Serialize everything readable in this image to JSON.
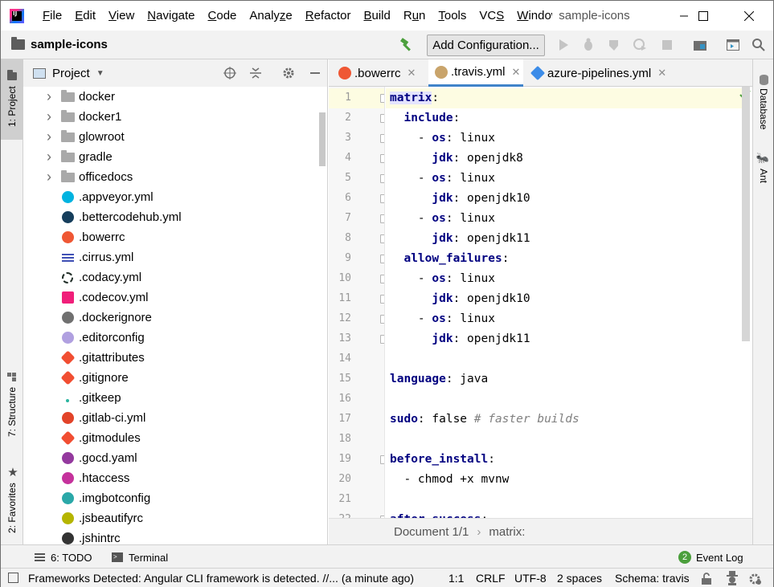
{
  "window": {
    "title": "sample-icons",
    "menu": [
      "File",
      "Edit",
      "View",
      "Navigate",
      "Code",
      "Analyze",
      "Refactor",
      "Build",
      "Run",
      "Tools",
      "VCS",
      "Window"
    ],
    "menu_mnemonics": [
      "F",
      "E",
      "V",
      "N",
      "C",
      "z",
      "R",
      "B",
      "u",
      "T",
      "S",
      "W"
    ]
  },
  "navbar": {
    "project_name": "sample-icons",
    "run_config_label": "Add Configuration..."
  },
  "left_stripe": {
    "project_tab": "1: Project",
    "structure_tab": "7: Structure",
    "favorites_tab": "2: Favorites"
  },
  "project_panel": {
    "title": "Project",
    "items": [
      {
        "label": "docker",
        "type": "folder",
        "icon": "docker-folder-icon",
        "color": "#a9a9a9"
      },
      {
        "label": "docker1",
        "type": "folder",
        "icon": "folder-icon",
        "color": "#a9a9a9"
      },
      {
        "label": "glowroot",
        "type": "folder",
        "icon": "folder-icon",
        "color": "#a9a9a9"
      },
      {
        "label": "gradle",
        "type": "folder",
        "icon": "gradle-folder-icon",
        "color": "#a9a9a9"
      },
      {
        "label": "officedocs",
        "type": "folder",
        "icon": "folder-icon",
        "color": "#a9a9a9"
      },
      {
        "label": ".appveyor.yml",
        "type": "file",
        "icon": "appveyor-icon",
        "color": "#00b3e0"
      },
      {
        "label": ".bettercodehub.yml",
        "type": "file",
        "icon": "bettercodehub-icon",
        "color": "#163e5c"
      },
      {
        "label": ".bowerrc",
        "type": "file",
        "icon": "bower-icon",
        "color": "#ef5734"
      },
      {
        "label": ".cirrus.yml",
        "type": "file",
        "icon": "cirrus-icon",
        "color": "#4051b5"
      },
      {
        "label": ".codacy.yml",
        "type": "file",
        "icon": "codacy-icon",
        "color": "#222f29"
      },
      {
        "label": ".codecov.yml",
        "type": "file",
        "icon": "codecov-icon",
        "color": "#f01f7a"
      },
      {
        "label": ".dockerignore",
        "type": "file",
        "icon": "docker-icon",
        "color": "#707070"
      },
      {
        "label": ".editorconfig",
        "type": "file",
        "icon": "editorconfig-icon",
        "color": "#b0a0e0"
      },
      {
        "label": ".gitattributes",
        "type": "file",
        "icon": "git-icon",
        "color": "#f14e32"
      },
      {
        "label": ".gitignore",
        "type": "file",
        "icon": "git-icon",
        "color": "#f14e32"
      },
      {
        "label": ".gitkeep",
        "type": "file",
        "icon": "gitkeep-icon",
        "color": "#2bb5a0"
      },
      {
        "label": ".gitlab-ci.yml",
        "type": "file",
        "icon": "gitlab-icon",
        "color": "#e24329"
      },
      {
        "label": ".gitmodules",
        "type": "file",
        "icon": "git-icon",
        "color": "#f14e32"
      },
      {
        "label": ".gocd.yaml",
        "type": "file",
        "icon": "gocd-icon",
        "color": "#94399e"
      },
      {
        "label": ".htaccess",
        "type": "file",
        "icon": "apache-feather-icon",
        "color": "#c5329c"
      },
      {
        "label": ".imgbotconfig",
        "type": "file",
        "icon": "imgbot-icon",
        "color": "#2aa8a8"
      },
      {
        "label": ".jsbeautifyrc",
        "type": "file",
        "icon": "jsbeautify-icon",
        "color": "#b5b500"
      },
      {
        "label": ".jshintrc",
        "type": "file",
        "icon": "jshint-icon",
        "color": "#333333"
      }
    ]
  },
  "editor": {
    "tabs": [
      {
        "label": ".bowerrc",
        "icon": "bower-icon",
        "active": false
      },
      {
        "label": ".travis.yml",
        "icon": "travis-icon",
        "active": true
      },
      {
        "label": "azure-pipelines.yml",
        "icon": "azure-pipelines-icon",
        "active": false
      }
    ],
    "lines": [
      {
        "n": "1",
        "tokens": [
          {
            "t": "matrix",
            "c": "k hl"
          },
          {
            "t": ":",
            "c": "v"
          }
        ]
      },
      {
        "n": "2",
        "tokens": [
          {
            "t": "  ",
            "c": "v"
          },
          {
            "t": "include",
            "c": "k"
          },
          {
            "t": ":",
            "c": "v"
          }
        ]
      },
      {
        "n": "3",
        "tokens": [
          {
            "t": "    - ",
            "c": "v"
          },
          {
            "t": "os",
            "c": "k"
          },
          {
            "t": ": linux",
            "c": "v"
          }
        ]
      },
      {
        "n": "4",
        "tokens": [
          {
            "t": "      ",
            "c": "v"
          },
          {
            "t": "jdk",
            "c": "k"
          },
          {
            "t": ": openjdk8",
            "c": "v"
          }
        ]
      },
      {
        "n": "5",
        "tokens": [
          {
            "t": "    - ",
            "c": "v"
          },
          {
            "t": "os",
            "c": "k"
          },
          {
            "t": ": linux",
            "c": "v"
          }
        ]
      },
      {
        "n": "6",
        "tokens": [
          {
            "t": "      ",
            "c": "v"
          },
          {
            "t": "jdk",
            "c": "k"
          },
          {
            "t": ": openjdk10",
            "c": "v"
          }
        ]
      },
      {
        "n": "7",
        "tokens": [
          {
            "t": "    - ",
            "c": "v"
          },
          {
            "t": "os",
            "c": "k"
          },
          {
            "t": ": linux",
            "c": "v"
          }
        ]
      },
      {
        "n": "8",
        "tokens": [
          {
            "t": "      ",
            "c": "v"
          },
          {
            "t": "jdk",
            "c": "k"
          },
          {
            "t": ": openjdk11",
            "c": "v"
          }
        ]
      },
      {
        "n": "9",
        "tokens": [
          {
            "t": "  ",
            "c": "v"
          },
          {
            "t": "allow_failures",
            "c": "k"
          },
          {
            "t": ":",
            "c": "v"
          }
        ]
      },
      {
        "n": "10",
        "tokens": [
          {
            "t": "    - ",
            "c": "v"
          },
          {
            "t": "os",
            "c": "k"
          },
          {
            "t": ": linux",
            "c": "v"
          }
        ]
      },
      {
        "n": "11",
        "tokens": [
          {
            "t": "      ",
            "c": "v"
          },
          {
            "t": "jdk",
            "c": "k"
          },
          {
            "t": ": openjdk10",
            "c": "v"
          }
        ]
      },
      {
        "n": "12",
        "tokens": [
          {
            "t": "    - ",
            "c": "v"
          },
          {
            "t": "os",
            "c": "k"
          },
          {
            "t": ": linux",
            "c": "v"
          }
        ]
      },
      {
        "n": "13",
        "tokens": [
          {
            "t": "      ",
            "c": "v"
          },
          {
            "t": "jdk",
            "c": "k"
          },
          {
            "t": ": openjdk11",
            "c": "v"
          }
        ]
      },
      {
        "n": "14",
        "tokens": []
      },
      {
        "n": "15",
        "tokens": [
          {
            "t": "language",
            "c": "k"
          },
          {
            "t": ": java",
            "c": "v"
          }
        ]
      },
      {
        "n": "16",
        "tokens": []
      },
      {
        "n": "17",
        "tokens": [
          {
            "t": "sudo",
            "c": "k"
          },
          {
            "t": ": false ",
            "c": "v"
          },
          {
            "t": "# faster builds",
            "c": "c"
          }
        ]
      },
      {
        "n": "18",
        "tokens": []
      },
      {
        "n": "19",
        "tokens": [
          {
            "t": "before_install",
            "c": "k"
          },
          {
            "t": ":",
            "c": "v"
          }
        ]
      },
      {
        "n": "20",
        "tokens": [
          {
            "t": "  - chmod +x mvnw",
            "c": "v"
          }
        ]
      },
      {
        "n": "21",
        "tokens": []
      },
      {
        "n": "22",
        "tokens": [
          {
            "t": "after_success",
            "c": "k"
          },
          {
            "t": ":",
            "c": "v"
          }
        ]
      }
    ],
    "breadcrumb": [
      "Document 1/1",
      "matrix:"
    ]
  },
  "right_stripe": {
    "database_tab": "Database",
    "ant_tab": "Ant"
  },
  "bottom_tools": {
    "todo_label": "6: TODO",
    "terminal_label": "Terminal",
    "event_log_label": "Event Log",
    "event_count": "2"
  },
  "statusbar": {
    "message": "Frameworks Detected: Angular CLI framework is detected. //... (a minute ago)",
    "position": "1:1",
    "line_separator": "CRLF",
    "encoding": "UTF-8",
    "indent": "2 spaces",
    "schema": "Schema: travis"
  },
  "colors": {
    "keyword": "#000080",
    "comment": "#808080",
    "current_line": "#fdfce2",
    "accent": "#4083c9",
    "run_hammer": "#4b9f3c"
  }
}
